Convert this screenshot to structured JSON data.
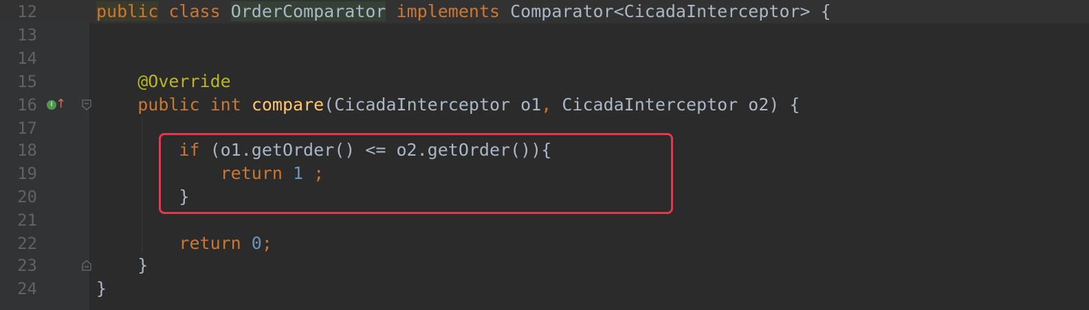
{
  "colors": {
    "background": "#2b2b2b",
    "keyword": "#cc7832",
    "annotation": "#bbb529",
    "method": "#ffc66d",
    "number": "#6897bb",
    "plain": "#a9b7c6",
    "annotation_box": "#e8364d"
  },
  "gutter_icons": [
    "implements-icon",
    "override-arrow-up-icon"
  ],
  "lines": [
    {
      "num": "12"
    },
    {
      "num": "13"
    },
    {
      "num": "14"
    },
    {
      "num": "15"
    },
    {
      "num": "16"
    },
    {
      "num": "17"
    },
    {
      "num": "18"
    },
    {
      "num": "19"
    },
    {
      "num": "20"
    },
    {
      "num": "21"
    },
    {
      "num": "22"
    },
    {
      "num": "23"
    },
    {
      "num": "24"
    }
  ],
  "code": {
    "l12": {
      "public": "public",
      "class": "class",
      "name": "OrderComparator",
      "implements": "implements",
      "rest": " Comparator<CicadaInterceptor> {"
    },
    "l15": {
      "annotation": "@Override"
    },
    "l16": {
      "public": "public",
      "int": "int",
      "method": "compare",
      "params": "(CicadaInterceptor o1",
      "comma": ",",
      "params2": " CicadaInterceptor o2) {"
    },
    "l18": {
      "if": "if",
      "cond": " (o1.getOrder() <= o2.getOrder()){"
    },
    "l19": {
      "return": "return",
      "value": "1",
      "semi": ";"
    },
    "l20": {
      "brace": "}"
    },
    "l22": {
      "return": "return",
      "value": "0",
      "semi": ";"
    },
    "l23": {
      "brace": "}"
    },
    "l24": {
      "brace": "}"
    }
  }
}
